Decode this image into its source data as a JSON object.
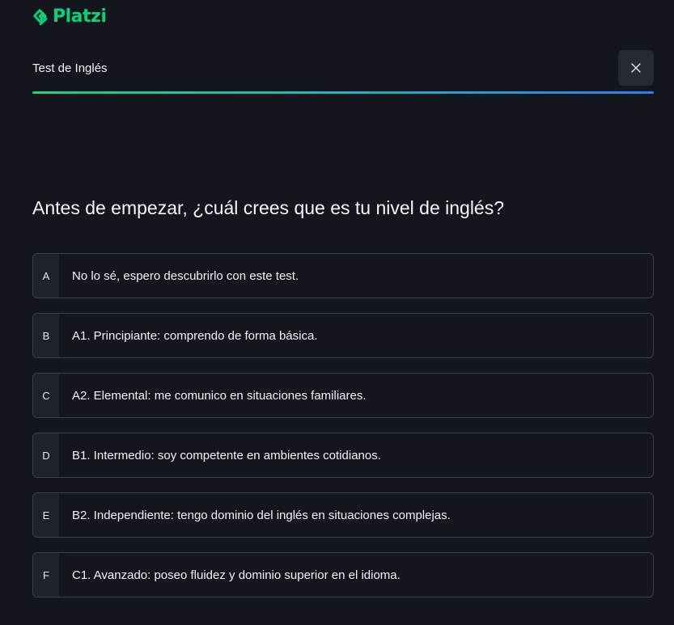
{
  "brand": {
    "name": "Platzi",
    "color": "#05d37c",
    "logo_icon": "platzi-logo-icon"
  },
  "header": {
    "title": "Test de Inglés",
    "close_icon": "close-icon"
  },
  "progress": {
    "value": 1.0,
    "gradient_start": "#13d682",
    "gradient_end": "#2a7ff0"
  },
  "question": {
    "text": "Antes de empezar, ¿cuál crees que es tu nivel de inglés?"
  },
  "options": [
    {
      "letter": "A",
      "text": "No lo sé, espero descubrirlo con este test."
    },
    {
      "letter": "B",
      "text": "A1. Principiante: comprendo de forma básica."
    },
    {
      "letter": "C",
      "text": "A2. Elemental: me comunico en situaciones familiares."
    },
    {
      "letter": "D",
      "text": "B1. Intermedio: soy competente en ambientes cotidianos."
    },
    {
      "letter": "E",
      "text": "B2. Independiente: tengo dominio del inglés en situaciones complejas."
    },
    {
      "letter": "F",
      "text": "C1. Avanzado: poseo fluidez y dominio superior en el idioma."
    }
  ],
  "colors": {
    "background": "#13161c",
    "option_border": "#3a3f4a",
    "letter_background": "#1e222a",
    "close_button_background": "#262a33"
  }
}
